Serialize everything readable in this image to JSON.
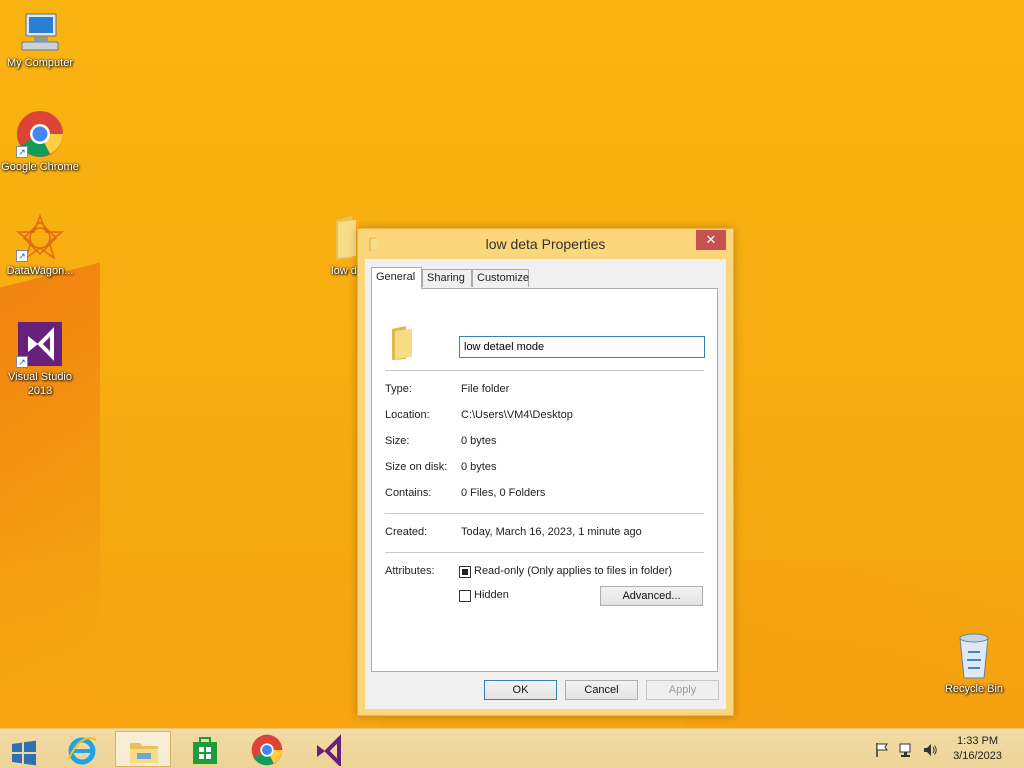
{
  "desktop": {
    "icons": [
      {
        "id": "my-computer",
        "label": "My Computer"
      },
      {
        "id": "google-chrome",
        "label": "Google Chrome"
      },
      {
        "id": "datawagon",
        "label": "DataWagon..."
      },
      {
        "id": "visual-studio",
        "label": "Visual Studio 2013"
      },
      {
        "id": "low-deta-folder",
        "label": "low d"
      },
      {
        "id": "recycle-bin",
        "label": "Recycle Bin"
      }
    ]
  },
  "dialog": {
    "title": "low deta Properties",
    "close_glyph": "✕",
    "tabs": [
      "General",
      "Sharing",
      "Customize"
    ],
    "name_value": "low detael mode",
    "properties": [
      {
        "label": "Type:",
        "value": "File folder"
      },
      {
        "label": "Location:",
        "value": "C:\\Users\\VM4\\Desktop"
      },
      {
        "label": "Size:",
        "value": "0 bytes"
      },
      {
        "label": "Size on disk:",
        "value": "0 bytes"
      },
      {
        "label": "Contains:",
        "value": "0 Files, 0 Folders"
      }
    ],
    "created": {
      "label": "Created:",
      "value": "Today, March 16, 2023, 1 minute ago"
    },
    "attributes": {
      "label": "Attributes:",
      "readonly_label": "Read-only (Only applies to files in folder)",
      "readonly_state": "indeterminate",
      "hidden_label": "Hidden",
      "hidden_checked": false,
      "advanced_button": "Advanced..."
    },
    "buttons": {
      "ok": "OK",
      "cancel": "Cancel",
      "apply": "Apply"
    }
  },
  "taskbar": {
    "items": [
      "start-button",
      "internet-explorer",
      "file-explorer",
      "windows-store",
      "google-chrome",
      "visual-studio"
    ],
    "active_item": "file-explorer",
    "clock": {
      "time": "1:33 PM",
      "date": "3/16/2023"
    }
  },
  "colors": {
    "wallpaper": "#f9b412",
    "dialog_frame": "#fbd67a",
    "close_button": "#c75050",
    "taskbar": "#f0d8a0",
    "focus_border": "#3c7fb1"
  }
}
